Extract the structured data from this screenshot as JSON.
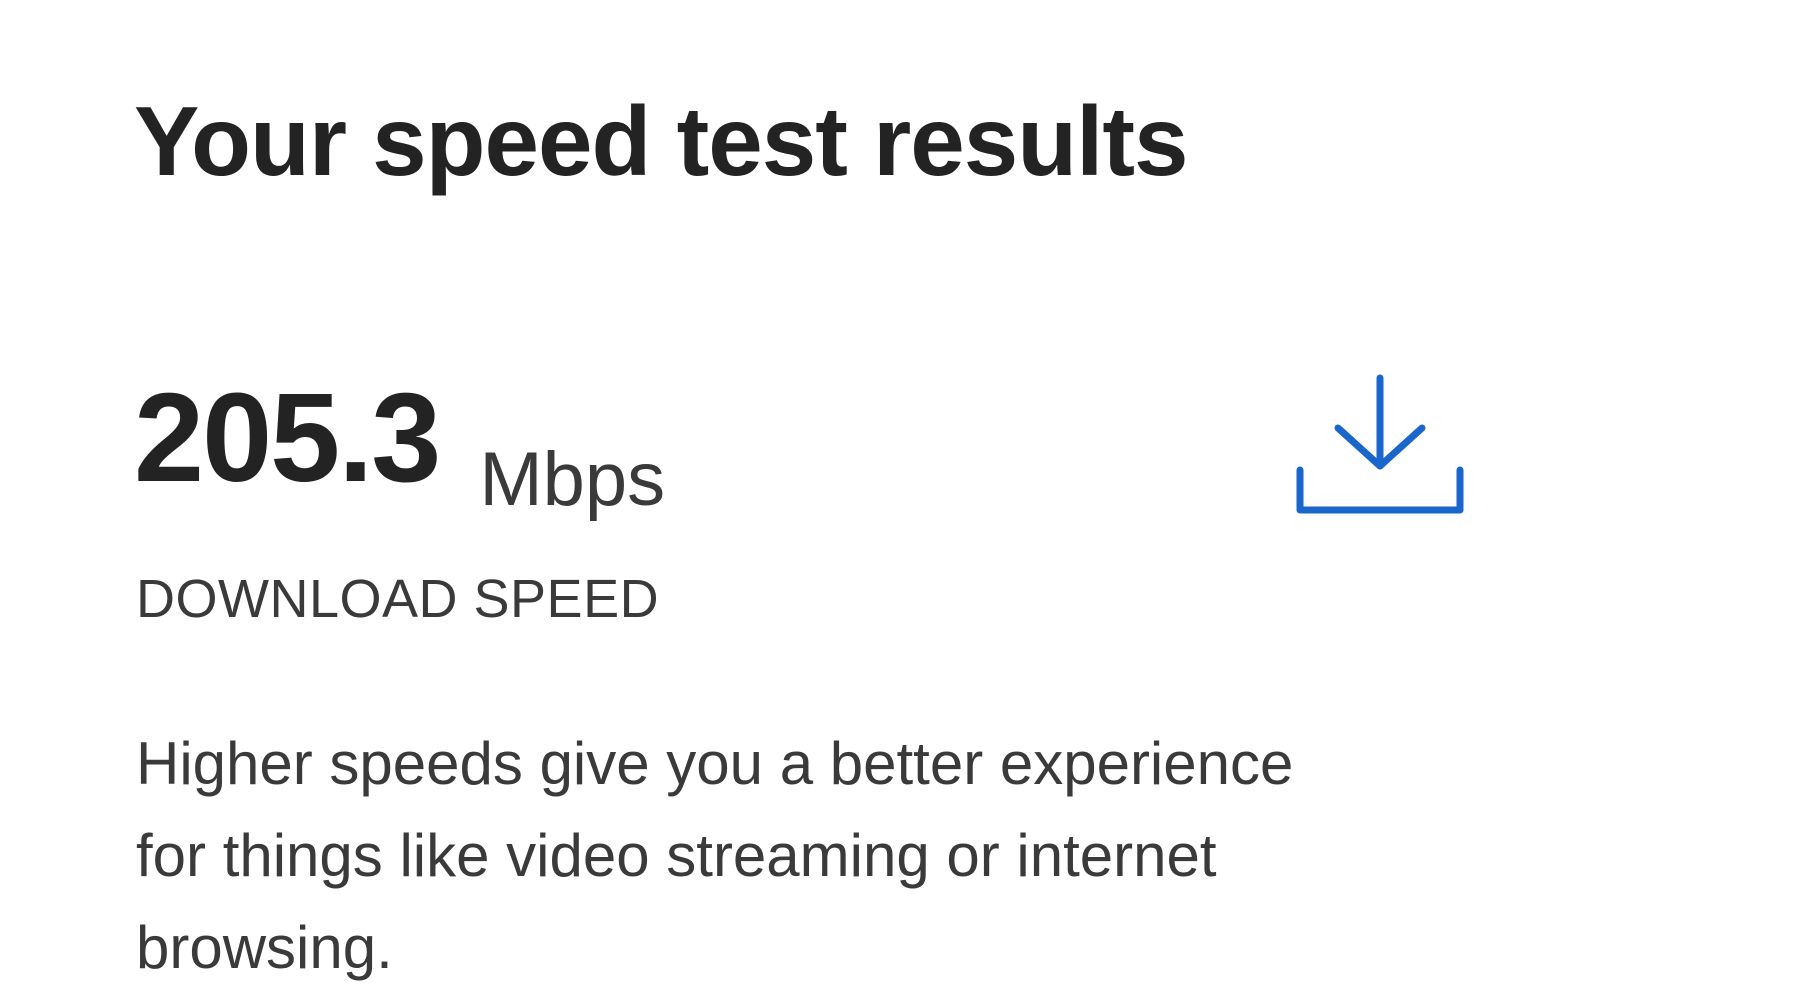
{
  "page": {
    "title": "Your speed test results"
  },
  "result": {
    "value": "205.3",
    "unit": "Mbps",
    "label": "DOWNLOAD SPEED",
    "icon": "download-icon",
    "accent_color": "#1a66cc"
  },
  "description": {
    "lines": [
      "Higher speeds give you a better experience",
      "for things like video streaming or internet",
      "browsing."
    ]
  }
}
